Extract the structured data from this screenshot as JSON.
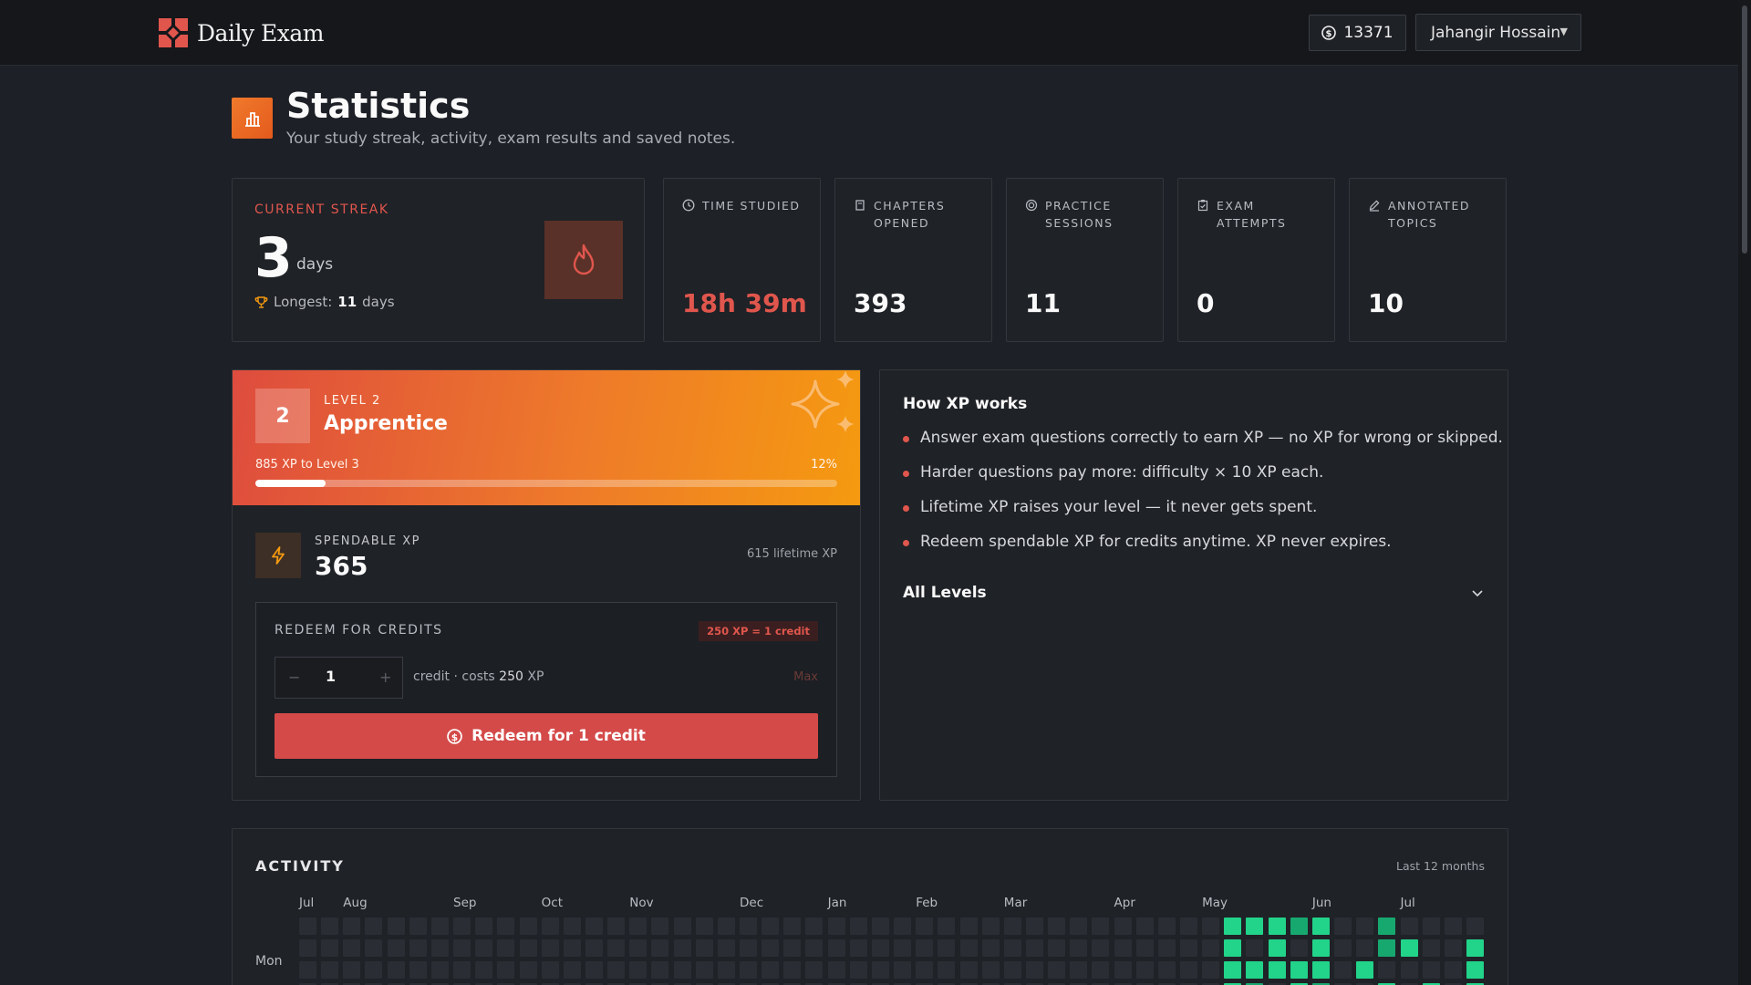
{
  "app": {
    "name": "Daily Exam"
  },
  "header": {
    "credits": "13371",
    "user_name": "Jahangir Hossain"
  },
  "page": {
    "title": "Statistics",
    "subtitle": "Your study streak, activity, exam results and saved notes."
  },
  "streak": {
    "label": "CURRENT STREAK",
    "value": "3",
    "unit": "days",
    "longest_label": "Longest:",
    "longest_value": "11",
    "longest_unit": "days"
  },
  "stats": [
    {
      "label_1": "TIME STUDIED",
      "label_2": "",
      "value": "18h 39m",
      "icon": "clock-icon"
    },
    {
      "label_1": "CHAPTERS",
      "label_2": "OPENED",
      "value": "393",
      "icon": "book-icon"
    },
    {
      "label_1": "PRACTICE",
      "label_2": "SESSIONS",
      "value": "11",
      "icon": "target-icon"
    },
    {
      "label_1": "EXAM",
      "label_2": "ATTEMPTS",
      "value": "0",
      "icon": "clipboard-icon"
    },
    {
      "label_1": "ANNOTATED",
      "label_2": "TOPICS",
      "value": "10",
      "icon": "pen-icon"
    }
  ],
  "level": {
    "number": "2",
    "small_label": "LEVEL 2",
    "name": "Apprentice",
    "to_next": "885 XP to Level 3",
    "percent_label": "12%",
    "progress": 0.12
  },
  "spendable": {
    "label": "SPENDABLE XP",
    "value": "365",
    "lifetime": "615 lifetime XP"
  },
  "redeem": {
    "title": "REDEEM FOR CREDITS",
    "rate": "250 XP = 1 credit",
    "minus": "−",
    "plus": "+",
    "quantity": "1",
    "cost_prefix": "credit · costs",
    "cost_value": "250",
    "cost_suffix": "XP",
    "max_label": "Max",
    "button_label": "Redeem for 1 credit"
  },
  "xp_info": {
    "title": "How XP works",
    "items": [
      "Answer exam questions correctly to earn XP — no XP for wrong or skipped.",
      "Harder questions pay more: difficulty × 10 XP each.",
      "Lifetime XP raises your level — it never gets spent.",
      "Redeem spendable XP for credits anytime. XP never expires."
    ],
    "all_levels": "All Levels"
  },
  "activity": {
    "title": "ACTIVITY",
    "range": "Last 12 months",
    "day_label": "Mon",
    "months": [
      "Jul",
      "Aug",
      "Sep",
      "Oct",
      "Nov",
      "Dec",
      "Jan",
      "Feb",
      "Mar",
      "Apr",
      "May",
      "Jun",
      "Jul"
    ],
    "month_weeks": [
      0,
      2,
      7,
      11,
      15,
      20,
      24,
      28,
      32,
      37,
      41,
      46,
      50
    ],
    "active": [
      [
        42,
        0,
        3
      ],
      [
        43,
        0,
        3
      ],
      [
        44,
        0,
        3
      ],
      [
        45,
        0,
        2
      ],
      [
        46,
        0,
        3
      ],
      [
        49,
        0,
        2
      ],
      [
        42,
        1,
        3
      ],
      [
        44,
        1,
        3
      ],
      [
        46,
        1,
        3
      ],
      [
        49,
        1,
        2
      ],
      [
        50,
        1,
        3
      ],
      [
        53,
        1,
        3
      ],
      [
        42,
        2,
        3
      ],
      [
        43,
        2,
        3
      ],
      [
        44,
        2,
        3
      ],
      [
        45,
        2,
        3
      ],
      [
        46,
        2,
        3
      ],
      [
        48,
        2,
        3
      ],
      [
        53,
        2,
        3
      ],
      [
        42,
        3,
        3
      ],
      [
        43,
        3,
        2
      ],
      [
        45,
        3,
        3
      ],
      [
        46,
        3,
        2
      ],
      [
        49,
        3,
        3
      ],
      [
        51,
        3,
        3
      ],
      [
        53,
        3,
        3
      ]
    ],
    "colors": {
      "empty": "#2a2d33",
      "level_2": "#17a870",
      "level_3": "#22d38a"
    }
  }
}
